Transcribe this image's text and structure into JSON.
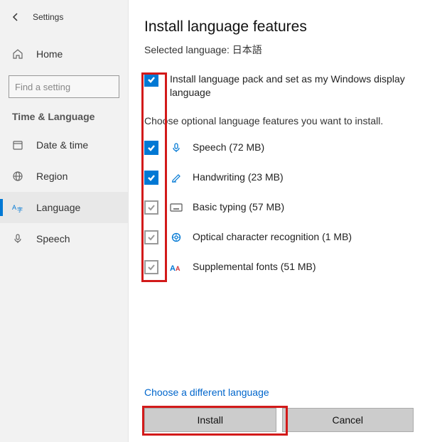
{
  "sidebar": {
    "app_title": "Settings",
    "home_label": "Home",
    "search_placeholder": "Find a setting",
    "section_label": "Time & Language",
    "items": [
      {
        "label": "Date & time"
      },
      {
        "label": "Region"
      },
      {
        "label": "Language"
      },
      {
        "label": "Speech"
      }
    ]
  },
  "main": {
    "title": "Install language features",
    "subtitle_prefix": "Selected language: ",
    "selected_language": "日本語",
    "primary_option": "Install language pack and set as my Windows display language",
    "prompt": "Choose optional language features you want to install.",
    "features": [
      {
        "label": "Speech (72 MB)"
      },
      {
        "label": "Handwriting (23 MB)"
      },
      {
        "label": "Basic typing (57 MB)"
      },
      {
        "label": "Optical character recognition (1 MB)"
      },
      {
        "label": "Supplemental fonts (51 MB)"
      }
    ],
    "link": "Choose a different language",
    "install_label": "Install",
    "cancel_label": "Cancel"
  }
}
